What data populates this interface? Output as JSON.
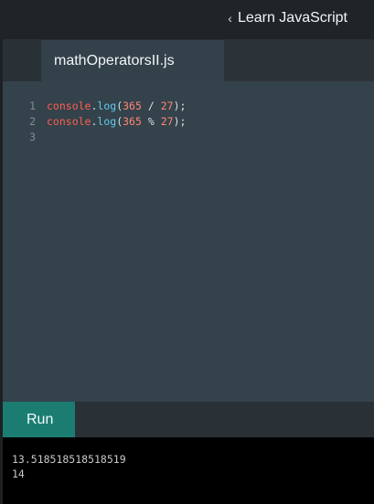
{
  "header": {
    "back_label": "Learn JavaScript",
    "back_icon": "chevron-left-icon"
  },
  "editor": {
    "tab_label": "mathOperatorsII.js",
    "code_lines": [
      {
        "line_number": "1",
        "object": "console",
        "dot": ".",
        "method": "log",
        "open": "(",
        "left": "365",
        "operator": "/",
        "right": "27",
        "close": ");"
      },
      {
        "line_number": "2",
        "object": "console",
        "dot": ".",
        "method": "log",
        "open": "(",
        "left": "365",
        "operator": "%",
        "right": "27",
        "close": ");"
      },
      {
        "line_number": "3"
      }
    ]
  },
  "actions": {
    "run_label": "Run"
  },
  "console": {
    "output_lines": [
      "13.518518518518519",
      "14"
    ]
  },
  "colors": {
    "header_bg": "#202427",
    "editor_bg": "#34424b",
    "tab_active_bg": "#33414b",
    "run_button_bg": "#1b7d72",
    "console_bg": "#000000",
    "token_object": "#ff5f4f",
    "token_method": "#5fcbe9",
    "token_number": "#ff8674"
  }
}
